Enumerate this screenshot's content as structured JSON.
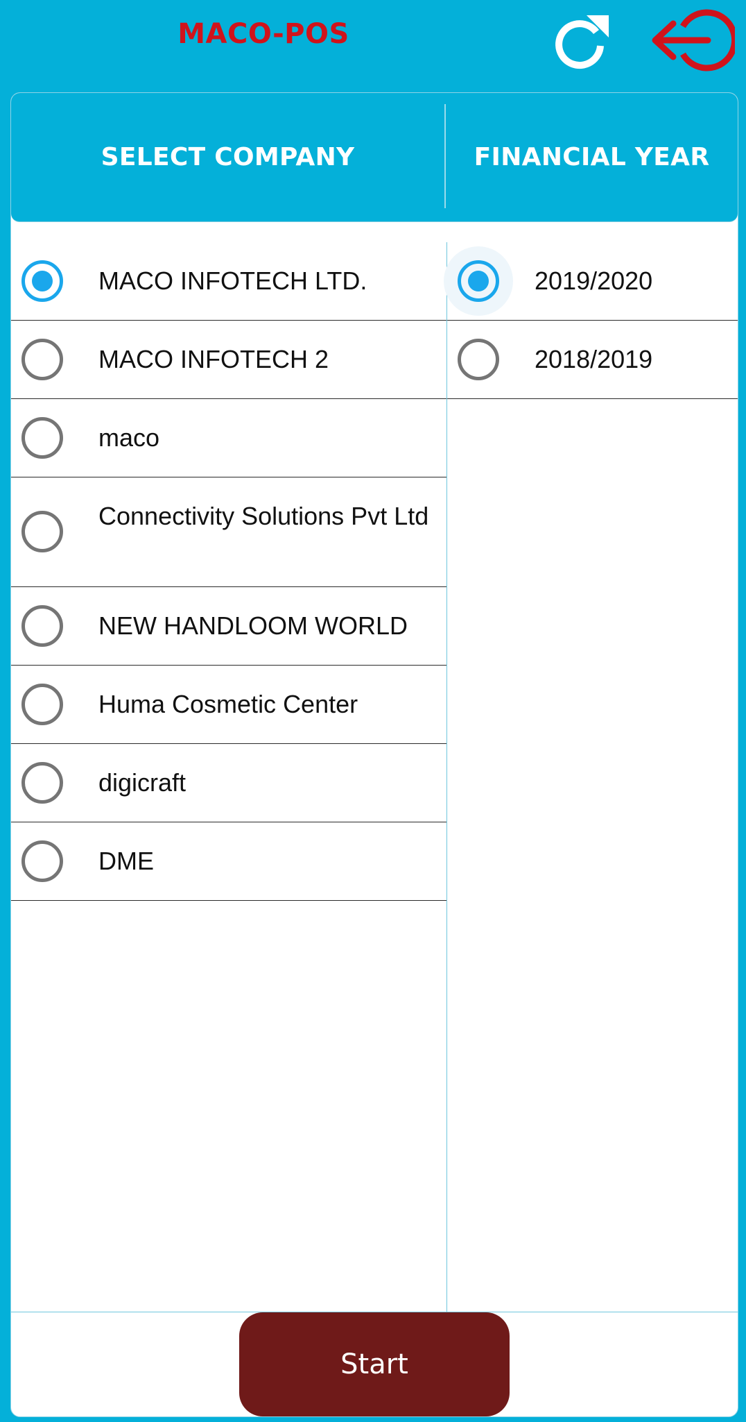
{
  "app": {
    "title": "MACO-POS",
    "refresh_icon": "refresh-icon",
    "logout_icon": "logout-icon",
    "colors": {
      "background": "#04b0d9",
      "title": "#d0131b",
      "radio_checked": "#1aa7ec",
      "start_button": "#6f1a19"
    }
  },
  "header": {
    "company_label": "SELECT COMPANY",
    "year_label": "FINANCIAL YEAR"
  },
  "companies": [
    {
      "name": "MACO INFOTECH LTD.",
      "selected": true
    },
    {
      "name": "MACO INFOTECH 2",
      "selected": false
    },
    {
      "name": "maco",
      "selected": false
    },
    {
      "name": "Connectivity Solutions Pvt Ltd",
      "selected": false
    },
    {
      "name": "NEW HANDLOOM WORLD",
      "selected": false
    },
    {
      "name": "Huma Cosmetic Center",
      "selected": false
    },
    {
      "name": "digicraft",
      "selected": false
    },
    {
      "name": "DME",
      "selected": false
    }
  ],
  "years": [
    {
      "name": "2019/2020",
      "selected": true
    },
    {
      "name": "2018/2019",
      "selected": false
    }
  ],
  "footer": {
    "start_label": "Start"
  }
}
